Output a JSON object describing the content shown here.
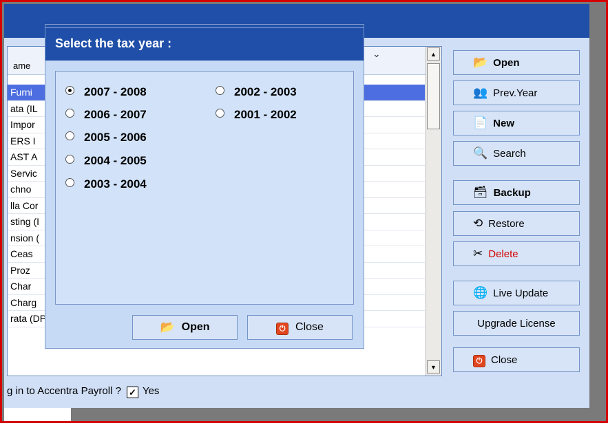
{
  "main": {
    "column_header": "ame",
    "rows": [
      "Furni",
      "ata (IL",
      "Impor",
      "ERS I",
      "AST A",
      "Servic",
      "chno",
      "lla Cor",
      "sting (I",
      "nsion (",
      "Ceas",
      "Proz",
      "Char",
      "Charg",
      "rata (DP)"
    ],
    "selected_row": 0,
    "login_prompt": "g in to Accentra Payroll ?",
    "login_checked": true,
    "login_checkbox_label": "Yes"
  },
  "sidebar": {
    "buttons": [
      {
        "label": "Open",
        "icon": "folder-open-icon"
      },
      {
        "label": "Prev.Year",
        "icon": "users-icon"
      },
      {
        "label": "New",
        "icon": "new-document-icon"
      },
      {
        "label": "Search",
        "icon": "binoculars-icon"
      },
      {
        "label": "Backup",
        "icon": "backup-icon"
      },
      {
        "label": "Restore",
        "icon": "restore-icon"
      },
      {
        "label": "Delete",
        "icon": "delete-icon"
      },
      {
        "label": "Live Update",
        "icon": "globe-icon"
      },
      {
        "label": "Upgrade License",
        "icon": ""
      },
      {
        "label": "Close",
        "icon": "close-icon"
      }
    ]
  },
  "dialog": {
    "title": "Select the tax year :",
    "years": [
      "2007 - 2008",
      "2006 - 2007",
      "2005 - 2006",
      "2004 - 2005",
      "2003 - 2004",
      "2002 - 2003",
      "2001 - 2002"
    ],
    "selected_year": "2007 - 2008",
    "open_label": "Open",
    "close_label": "Close"
  },
  "colors": {
    "title_bar": "#1f4fa8",
    "window_body": "#d0dff6",
    "selection": "#4d6ee0",
    "frame_border": "#d40000",
    "delete_text": "#d40000"
  }
}
